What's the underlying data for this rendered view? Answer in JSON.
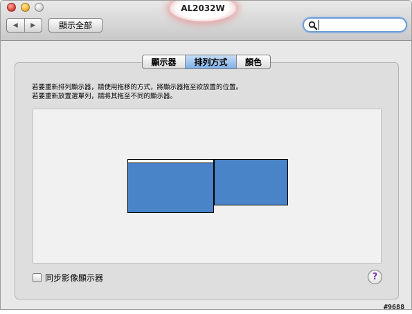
{
  "window": {
    "title": "AL2032W"
  },
  "toolbar": {
    "back_glyph": "◀",
    "forward_glyph": "▶",
    "show_all_label": "顯示全部",
    "search": {
      "value": "",
      "placeholder": ""
    }
  },
  "tabs": [
    {
      "label": "顯示器",
      "selected": false
    },
    {
      "label": "排列方式",
      "selected": true
    },
    {
      "label": "顏色",
      "selected": false
    }
  ],
  "instructions": {
    "line1": "若要重新排列顯示器，請使用拖移的方式，將顯示器拖至欲放置的位置。",
    "line2": "若要重新放置選單列，請將其拖至不同的顯示器。"
  },
  "displays": {
    "color": "#4a84c8"
  },
  "mirror": {
    "label": "同步影像顯示器",
    "checked": false
  },
  "help": {
    "glyph": "?"
  },
  "watermark": "#9688"
}
